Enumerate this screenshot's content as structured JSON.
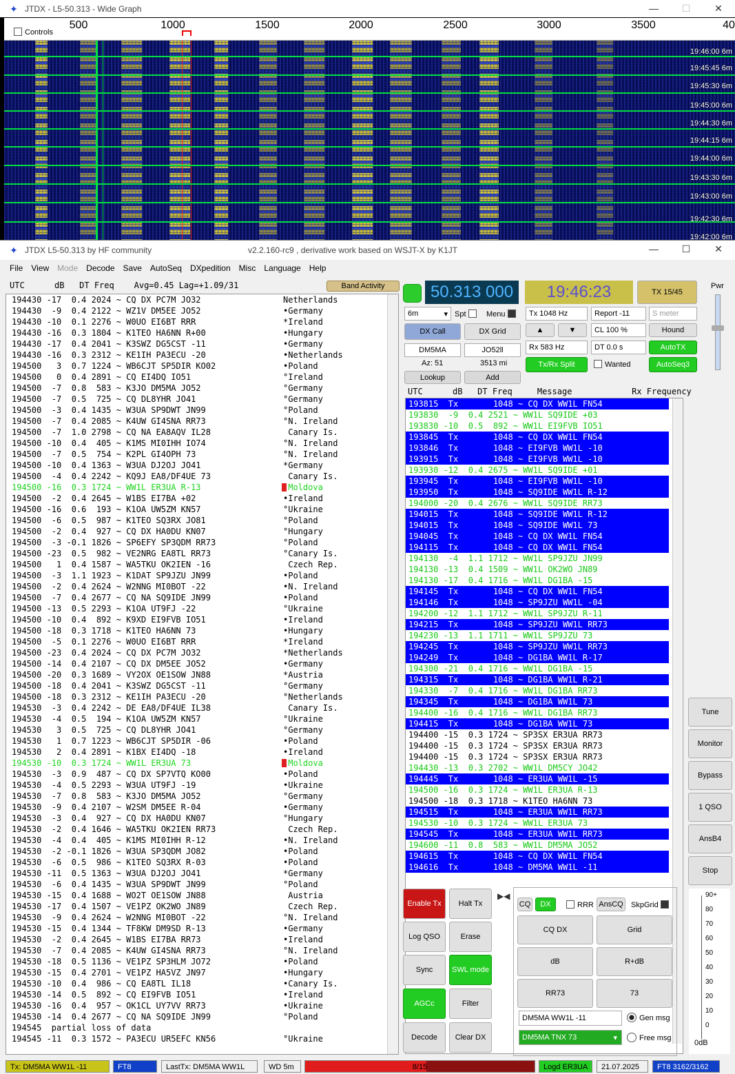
{
  "wide_graph": {
    "title": "JTDX - L5-50.313 - Wide Graph",
    "controls_label": "Controls",
    "scale": [
      "500",
      "1000",
      "1500",
      "2000",
      "2500",
      "3000",
      "3500",
      "40"
    ],
    "timestamps": [
      "19:46:00  6m",
      "19:45:45  6m",
      "19:45:30  6m",
      "19:45:00  6m",
      "19:44:30  6m",
      "19:44:15  6m",
      "19:44:00  6m",
      "19:43:30  6m",
      "19:43:00  6m",
      "19:42:30  6m",
      "19:42:00  6m"
    ]
  },
  "main": {
    "title": "JTDX   L5-50.313  by HF community",
    "subtitle": "v2.2.160-rc9 , derivative work based on WSJT-X by K1JT",
    "menu": [
      "File",
      "View",
      "Mode",
      "Decode",
      "Save",
      "AutoSeq",
      "DXpedition",
      "Misc",
      "Language",
      "Help"
    ],
    "left_header": "UTC      dB   DT Freq    Avg=0.45 Lag=+1.09/31",
    "band_activity": "Band Activity",
    "left_rows": [
      [
        "194430 -17  0.4 2024 ~ CQ DX PC7M JO32",
        "Netherlands",
        ""
      ],
      [
        "194430  -9  0.4 2122 ~ WZ1V DM5EE JO52",
        "•Germany",
        ""
      ],
      [
        "194430 -10  0.1 2276 ~ W0UO EI6BT RRR",
        "*Ireland",
        ""
      ],
      [
        "194430 -16  0.3 1804 ~ K1TEO HA6NN R+00",
        "•Hungary",
        ""
      ],
      [
        "194430 -17  0.4 2041 ~ K3SWZ DG5CST -11",
        "•Germany",
        ""
      ],
      [
        "194430 -16  0.3 2312 ~ KE1IH PA3ECU -20",
        "•Netherlands",
        ""
      ],
      [
        "194500   3  0.7 1224 ~ WB6CJT SP5DIR KO02",
        "•Poland",
        ""
      ],
      [
        "194500   0  0.4 2891 ~ CQ EI4DQ IO51",
        "°Ireland",
        ""
      ],
      [
        "194500  -7  0.8  583 ~ K3JO DM5MA JO52",
        "°Germany",
        ""
      ],
      [
        "194500  -7  0.5  725 ~ CQ DL8YHR JO41",
        "°Germany",
        ""
      ],
      [
        "194500  -3  0.4 1435 ~ W3UA SP9DWT JN99",
        "°Poland",
        ""
      ],
      [
        "194500  -7  0.4 2085 ~ K4UW GI4SNA RR73",
        "°N. Ireland",
        ""
      ],
      [
        "194500  -7  1.0 2798 ~ CQ NA EA8AQV IL28",
        " Canary Is.",
        ""
      ],
      [
        "194500 -10  0.4  405 ~ K1MS MI0IHH IO74",
        "°N. Ireland",
        ""
      ],
      [
        "194500  -7  0.5  754 ~ K2PL GI4OPH 73",
        "°N. Ireland",
        ""
      ],
      [
        "194500 -10  0.4 1363 ~ W3UA DJ2OJ JO41",
        "*Germany",
        ""
      ],
      [
        "194500  -4  0.4 2242 ~ KQ9J EA8/DF4UE 73",
        " Canary Is.",
        ""
      ],
      [
        "194500 -16  0.3 1724 ~ WW1L ER3UA R-13",
        " Moldova",
        "g"
      ],
      [
        "194500  -2  0.4 2645 ~ W1BS EI7BA +02",
        "•Ireland",
        ""
      ],
      [
        "194500 -16  0.6  193 ~ K1OA UW5ZM KN57",
        "°Ukraine",
        ""
      ],
      [
        "194500  -6  0.5  987 ~ K1TEO SQ3RX JO81",
        "°Poland",
        ""
      ],
      [
        "194500  -2  0.4  927 ~ CQ DX HA0DU KN07",
        "°Hungary",
        ""
      ],
      [
        "194500  -3 -0.1 1826 ~ SP6EFY SP3QDM RR73",
        "°Poland",
        ""
      ],
      [
        "194500 -23  0.5  982 ~ VE2NRG EA8TL RR73",
        "°Canary Is.",
        ""
      ],
      [
        "194500   1  0.4 1587 ~ WA5TKU OK2IEN -16",
        " Czech Rep.",
        ""
      ],
      [
        "194500  -3  1.1 1923 ~ K1DAT SP9JZU JN99",
        "•Poland",
        ""
      ],
      [
        "194500  -2  0.4 2624 ~ W2NNG MI0BOT -22",
        "•N. Ireland",
        ""
      ],
      [
        "194500  -7  0.4 2677 ~ CQ NA SQ9IDE JN99",
        "•Poland",
        ""
      ],
      [
        "194500 -13  0.5 2293 ~ K1OA UT9FJ -22",
        "°Ukraine",
        ""
      ],
      [
        "194500 -10  0.4  892 ~ K9XD EI9FVB IO51",
        "•Ireland",
        ""
      ],
      [
        "194500 -18  0.3 1718 ~ K1TEO HA6NN 73",
        "•Hungary",
        ""
      ],
      [
        "194500  -5  0.1 2276 ~ W0UO EI6BT RRR",
        "*Ireland",
        ""
      ],
      [
        "194500 -23  0.4 2024 ~ CQ DX PC7M JO32",
        "*Netherlands",
        ""
      ],
      [
        "194500 -14  0.4 2107 ~ CQ DX DM5EE JO52",
        "•Germany",
        ""
      ],
      [
        "194500 -20  0.3 1689 ~ VY2OX OE1SOW JN88",
        "*Austria",
        ""
      ],
      [
        "194500 -18  0.4 2041 ~ K3SWZ DG5CST -11",
        "°Germany",
        ""
      ],
      [
        "194500 -18  0.3 2312 ~ KE1IH PA3ECU -20",
        "°Netherlands",
        ""
      ],
      [
        "194530  -3  0.4 2242 ~ DE EA8/DF4UE IL38",
        " Canary Is.",
        ""
      ],
      [
        "194530  -4  0.5  194 ~ K1OA UW5ZM KN57",
        "°Ukraine",
        ""
      ],
      [
        "194530   3  0.5  725 ~ CQ DL8YHR JO41",
        "°Germany",
        ""
      ],
      [
        "194530   1  0.7 1223 ~ WB6CJT SP5DIR -06",
        "•Poland",
        ""
      ],
      [
        "194530   2  0.4 2891 ~ K1BX EI4DQ -18",
        "•Ireland",
        ""
      ],
      [
        "194530 -10  0.3 1724 ~ WW1L ER3UA 73",
        " Moldova",
        "g"
      ],
      [
        "194530  -3  0.9  487 ~ CQ DX SP7VTQ KO00",
        "•Poland",
        ""
      ],
      [
        "194530  -4  0.5 2293 ~ W3UA UT9FJ -19",
        "•Ukraine",
        ""
      ],
      [
        "194530  -7  0.8  583 ~ K3JO DM5MA JO52",
        "°Germany",
        ""
      ],
      [
        "194530  -9  0.4 2107 ~ W2SM DM5EE R-04",
        "•Germany",
        ""
      ],
      [
        "194530  -3  0.4  927 ~ CQ DX HA0DU KN07",
        "°Hungary",
        ""
      ],
      [
        "194530  -2  0.4 1646 ~ WA5TKU OK2IEN RR73",
        " Czech Rep.",
        ""
      ],
      [
        "194530  -4  0.4  405 ~ K1MS MI0IHH R-12",
        "•N. Ireland",
        ""
      ],
      [
        "194530  -2 -0.1 1826 ~ W3UA SP3QDM JO82",
        "•Poland",
        ""
      ],
      [
        "194530  -6  0.5  986 ~ K1TEO SQ3RX R-03",
        "•Poland",
        ""
      ],
      [
        "194530 -11  0.5 1363 ~ W3UA DJ2OJ JO41",
        "*Germany",
        ""
      ],
      [
        "194530  -6  0.4 1435 ~ W3UA SP9DWT JN99",
        "°Poland",
        ""
      ],
      [
        "194530 -15  0.4 1688 ~ WO2T OE1SOW JN88",
        " Austria",
        ""
      ],
      [
        "194530 -17  0.4 1507 ~ VE1PZ OK2WO JN89",
        " Czech Rep.",
        ""
      ],
      [
        "194530  -9  0.4 2624 ~ W2NNG MI0BOT -22",
        "°N. Ireland",
        ""
      ],
      [
        "194530 -15  0.4 1344 ~ TF8KW DM9SD R-13",
        "•Germany",
        ""
      ],
      [
        "194530  -2  0.4 2645 ~ W1BS EI7BA RR73",
        "•Ireland",
        ""
      ],
      [
        "194530  -7  0.4 2085 ~ K4UW GI4SNA RR73",
        "°N. Ireland",
        ""
      ],
      [
        "194530 -18  0.5 1136 ~ VE1PZ SP3HLM JO72",
        "•Poland",
        ""
      ],
      [
        "194530 -15  0.4 2701 ~ VE1PZ HA5VZ JN97",
        "•Hungary",
        ""
      ],
      [
        "194530 -10  0.4  986 ~ CQ EA8TL IL18",
        "•Canary Is.",
        ""
      ],
      [
        "194530 -14  0.5  892 ~ CQ EI9FVB IO51",
        "•Ireland",
        ""
      ],
      [
        "194530 -16  0.4  957 ~ OK1CL UY7VV RR73",
        "•Ukraine",
        ""
      ],
      [
        "194530 -14  0.4 2677 ~ CQ NA SQ9IDE JN99",
        "°Poland",
        ""
      ],
      [
        "194545  partial loss of data",
        "",
        ""
      ],
      [
        "194545 -11  0.3 1572 ~ PA3ECU UR5EFC KN56",
        "°Ukraine",
        ""
      ]
    ],
    "freq": "50.313 000",
    "clock": "19:46:23",
    "tx_period": "TX 15/45",
    "pwr": "Pwr",
    "band_sel": "6m",
    "spt": "Spt",
    "menu_cb": "Menu",
    "tx_hz": "Tx  1048  Hz",
    "report": "Report  -11",
    "smeter_ph": "S meter",
    "rx_hz": "Rx  583  Hz",
    "cl": "CL  100  %",
    "dt": "DT  0.0 s",
    "dx_call_btn": "DX Call",
    "dx_grid_btn": "DX Grid",
    "dx_call": "DM5MA",
    "dx_grid": "JO52ll",
    "az": "Az: 51",
    "dist": "3513 mi",
    "lookup": "Lookup",
    "add": "Add",
    "hound": "Hound",
    "autotx": "AutoTX",
    "txrx_split": "Tx/Rx Split",
    "wanted": "Wanted",
    "autoseq3": "AutoSeq3",
    "right_header": "UTC      dB   DT Freq     Message            Rx Frequency",
    "right_rows": [
      [
        "193815  Tx       1048 ~ CQ DX WW1L FN54",
        "tx"
      ],
      [
        "193830  -9  0.4 2521 ~ WW1L SQ9IDE +03",
        "gr"
      ],
      [
        "193830 -10  0.5  892 ~ WW1L EI9FVB IO51",
        "gr"
      ],
      [
        "193845  Tx       1048 ~ CQ DX WW1L FN54",
        "tx"
      ],
      [
        "193846  Tx       1048 ~ EI9FVB WW1L -10",
        "tx"
      ],
      [
        "193915  Tx       1048 ~ EI9FVB WW1L -10",
        "tx"
      ],
      [
        "193930 -12  0.4 2675 ~ WW1L SQ9IDE +01",
        "gr"
      ],
      [
        "193945  Tx       1048 ~ EI9FVB WW1L -10",
        "tx"
      ],
      [
        "193950  Tx       1048 ~ SQ9IDE WW1L R-12",
        "tx"
      ],
      [
        "194000 -20  0.4 2676 ~ WW1L SQ9IDE RR73",
        "gr"
      ],
      [
        "194015  Tx       1048 ~ SQ9IDE WW1L R-12",
        "tx"
      ],
      [
        "194015  Tx       1048 ~ SQ9IDE WW1L 73",
        "tx"
      ],
      [
        "194045  Tx       1048 ~ CQ DX WW1L FN54",
        "tx"
      ],
      [
        "194115  Tx       1048 ~ CQ DX WW1L FN54",
        "tx"
      ],
      [
        "194130  -4  1.1 1712 ~ WW1L SP9JZU JN99",
        "gr"
      ],
      [
        "194130 -13  0.4 1509 ~ WW1L OK2WO JN89",
        "gr"
      ],
      [
        "194130 -17  0.4 1716 ~ WW1L DG1BA -15",
        "gr"
      ],
      [
        "194145  Tx       1048 ~ CQ DX WW1L FN54",
        "tx"
      ],
      [
        "194146  Tx       1048 ~ SP9JZU WW1L -04",
        "tx"
      ],
      [
        "194200 -12  1.1 1712 ~ WW1L SP9JZU R-11",
        "gr"
      ],
      [
        "194215  Tx       1048 ~ SP9JZU WW1L RR73",
        "tx"
      ],
      [
        "194230 -13  1.1 1711 ~ WW1L SP9JZU 73",
        "gr"
      ],
      [
        "194245  Tx       1048 ~ SP9JZU WW1L RR73",
        "tx"
      ],
      [
        "194249  Tx       1048 ~ DG1BA WW1L R-17",
        "tx"
      ],
      [
        "194300 -21  0.4 1716 ~ WW1L DG1BA -15",
        "gr"
      ],
      [
        "194315  Tx       1048 ~ DG1BA WW1L R-21",
        "tx"
      ],
      [
        "194330  -7  0.4 1716 ~ WW1L DG1BA RR73",
        "gr"
      ],
      [
        "194345  Tx       1048 ~ DG1BA WW1L 73",
        "tx"
      ],
      [
        "194400 -16  0.4 1716 ~ WW1L DG1BA RR73",
        "gr"
      ],
      [
        "194415  Tx       1048 ~ DG1BA WW1L 73",
        "tx"
      ],
      [
        "194400 -15  0.3 1724 ~ SP3SX ER3UA RR73",
        ""
      ],
      [
        "194400 -15  0.3 1724 ~ SP3SX ER3UA RR73",
        ""
      ],
      [
        "194400 -15  0.3 1724 ~ SP3SX ER3UA RR73",
        ""
      ],
      [
        "194430 -13  0.3 2702 ~ WW1L DM5CY JO42",
        "gr"
      ],
      [
        "194445  Tx       1048 ~ ER3UA WW1L -15",
        "tx"
      ],
      [
        "194500 -16  0.3 1724 ~ WW1L ER3UA R-13",
        "gr"
      ],
      [
        "194500 -18  0.3 1718 ~ K1TEO HA6NN 73",
        ""
      ],
      [
        "194515  Tx       1048 ~ ER3UA WW1L RR73",
        "tx"
      ],
      [
        "194530 -10  0.3 1724 ~ WW1L ER3UA 73",
        "gr"
      ],
      [
        "194545  Tx       1048 ~ ER3UA WW1L RR73",
        "tx"
      ],
      [
        "194600 -11  0.8  583 ~ WW1L DM5MA JO52",
        "gr"
      ],
      [
        "194615  Tx       1048 ~ CQ DX WW1L FN54",
        "tx"
      ],
      [
        "194616  Tx       1048 ~ DM5MA WW1L -11",
        "tx"
      ]
    ],
    "side_buttons": [
      "Tune",
      "Monitor",
      "Bypass",
      "1 QSO",
      "AnsB4",
      "Stop"
    ],
    "enable_tx": "Enable Tx",
    "halt_tx": "Halt Tx",
    "log_qso": "Log QSO",
    "erase": "Erase",
    "sync": "Sync",
    "swl_mode": "SWL mode",
    "agcc": "AGCc",
    "filter": "Filter",
    "decode": "Decode",
    "clear_dx": "Clear DX",
    "cq": "CQ",
    "dx": "DX",
    "rrr": "RRR",
    "anscq": "AnsCQ",
    "skpgrid": "SkpGrid",
    "grid_btns": [
      "CQ DX",
      "Grid",
      "dB",
      "R+dB",
      "RR73",
      "73"
    ],
    "gen_msg_field": "DM5MA WW1L -11",
    "gen_msg": "Gen msg",
    "free_msg_field": "DM5MA TNX 73",
    "free_msg": "Free msg",
    "meter_ticks": [
      "90+",
      "80",
      "70",
      "60",
      "50",
      "40",
      "30",
      "20",
      "10",
      "0"
    ],
    "meter_unit": "0dB",
    "status": {
      "tx": "Tx: DM5MA WW1L -11",
      "mode": "FT8",
      "last_tx": "LastTx: DM5MA WW1L -11",
      "wd": "WD 5m",
      "progress": "8/15",
      "progress_frac": 0.53,
      "logd": "Logd ER3UA",
      "date": "21.07.2025",
      "count": "FT8  3162/3162"
    }
  }
}
